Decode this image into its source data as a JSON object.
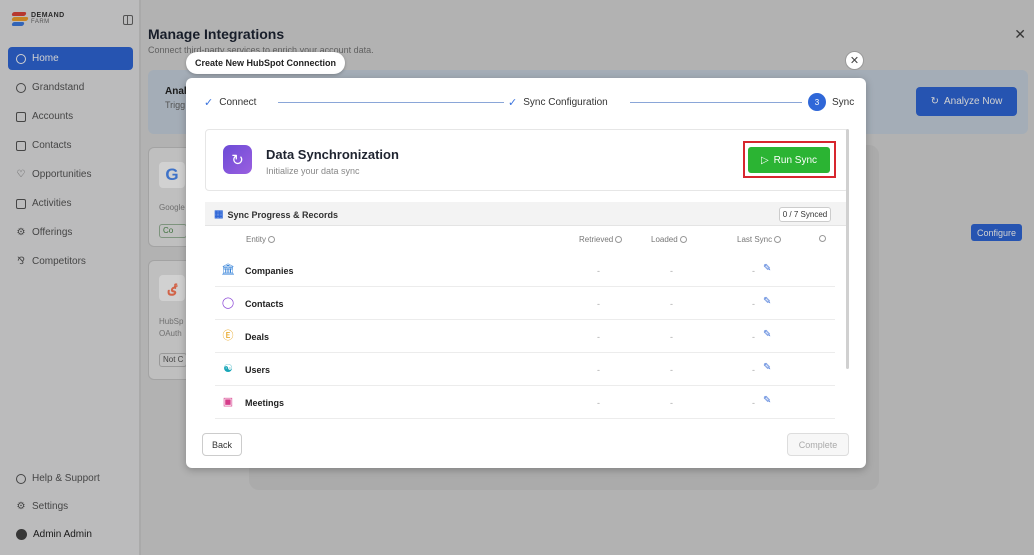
{
  "sidebar": {
    "logo_line1": "DEMAND",
    "logo_line2": "FARM",
    "items": [
      {
        "label": "Home",
        "icon": "home-icon"
      },
      {
        "label": "Grandstand",
        "icon": "clock-icon"
      },
      {
        "label": "Accounts",
        "icon": "building-icon"
      },
      {
        "label": "Contacts",
        "icon": "contact-card-icon"
      },
      {
        "label": "Opportunities",
        "icon": "handshake-icon"
      },
      {
        "label": "Activities",
        "icon": "calendar-icon"
      },
      {
        "label": "Offerings",
        "icon": "gear-icon"
      },
      {
        "label": "Competitors",
        "icon": "people-icon"
      }
    ],
    "bottom": [
      {
        "label": "Help & Support",
        "icon": "help-icon"
      },
      {
        "label": "Settings",
        "icon": "settings-icon"
      },
      {
        "label": "Admin Admin",
        "icon": "avatar"
      }
    ]
  },
  "page": {
    "title": "Manage Integrations",
    "subtitle": "Connect third-party services to enrich your account data.",
    "banner_title": "Anal",
    "banner_sub": "Trigg",
    "analyze_label": "Analyze Now",
    "configure_label": "Configure",
    "google_card": {
      "logo": "G",
      "text": "Google",
      "badge": "Co"
    },
    "hubspot_card": {
      "text1": "HubSp",
      "text2": "OAuth",
      "badge": "Not C"
    }
  },
  "modal": {
    "tab_title": "Create New HubSpot Connection",
    "steps": [
      {
        "label": "Connect",
        "state": "done"
      },
      {
        "label": "Sync Configuration",
        "state": "done"
      },
      {
        "label": "Sync",
        "state": "current",
        "number": "3"
      }
    ],
    "sync": {
      "title": "Data Synchronization",
      "subtitle": "Initialize your data sync",
      "run_label": "Run Sync"
    },
    "progress": {
      "title": "Sync Progress & Records",
      "count": "0 / 7 Synced",
      "columns": {
        "entity": "Entity",
        "retrieved": "Retrieved",
        "loaded": "Loaded",
        "last_sync": "Last Sync"
      },
      "rows": [
        {
          "name": "Companies",
          "icon": "bank-icon",
          "color": "#2f7fd8",
          "retrieved": "-",
          "loaded": "-",
          "last": "-"
        },
        {
          "name": "Contacts",
          "icon": "person-icon",
          "color": "#8a45d6",
          "retrieved": "-",
          "loaded": "-",
          "last": "-"
        },
        {
          "name": "Deals",
          "icon": "dollar-icon",
          "color": "#e6a21a",
          "retrieved": "-",
          "loaded": "-",
          "last": "-"
        },
        {
          "name": "Users",
          "icon": "users-icon",
          "color": "#19a6b8",
          "retrieved": "-",
          "loaded": "-",
          "last": "-"
        },
        {
          "name": "Meetings",
          "icon": "calendar-icon",
          "color": "#d63c8a",
          "retrieved": "-",
          "loaded": "-",
          "last": "-"
        }
      ]
    },
    "back_label": "Back",
    "complete_label": "Complete"
  },
  "colors": {
    "primary": "#2f67d8",
    "run_sync_green": "#2bb433",
    "highlight_red": "#d7262e"
  }
}
